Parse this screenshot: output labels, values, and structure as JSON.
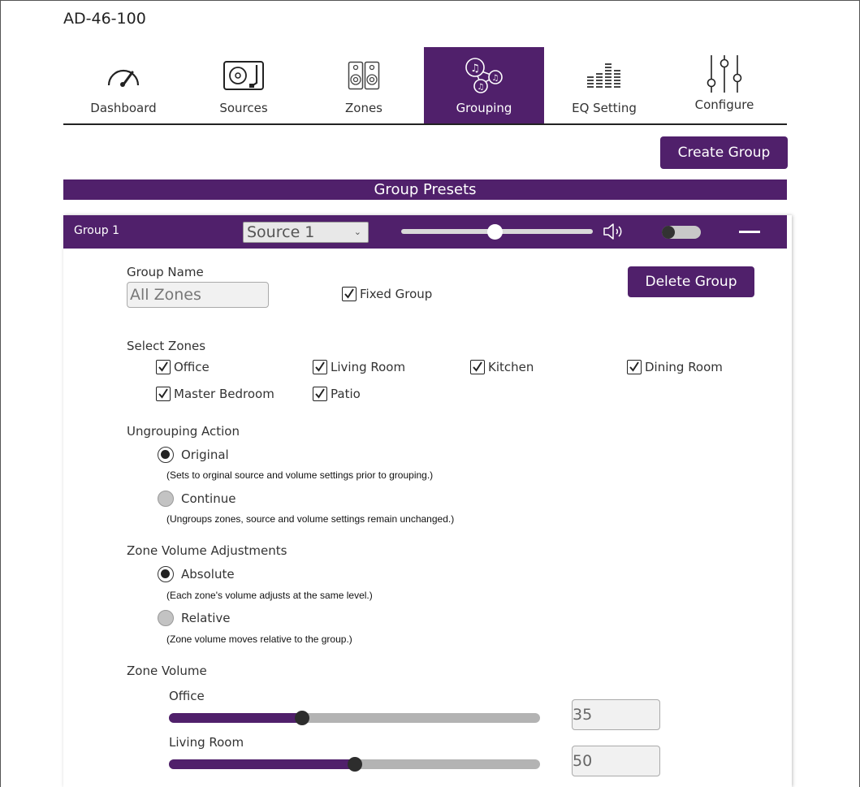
{
  "device": {
    "title": "AD-46-100"
  },
  "nav": {
    "tabs": [
      {
        "label": "Dashboard",
        "icon": "gauge-icon"
      },
      {
        "label": "Sources",
        "icon": "turntable-icon"
      },
      {
        "label": "Zones",
        "icon": "speakers-icon"
      },
      {
        "label": "Grouping",
        "icon": "music-group-icon",
        "active": true
      },
      {
        "label": "EQ Setting",
        "icon": "equalizer-icon"
      },
      {
        "label": "Configure",
        "icon": "sliders-icon"
      }
    ]
  },
  "actions": {
    "create_group": "Create Group"
  },
  "presets": {
    "title": "Group Presets"
  },
  "group": {
    "label": "Group 1",
    "source": "Source 1",
    "volume_fraction": 0.49,
    "enabled": false,
    "name_label": "Group Name",
    "name_value": "All Zones",
    "fixed_label": "Fixed Group",
    "fixed_checked": true,
    "delete_label": "Delete Group"
  },
  "zones": {
    "title": "Select Zones",
    "items": [
      {
        "label": "Office",
        "checked": true
      },
      {
        "label": "Living Room",
        "checked": true
      },
      {
        "label": "Kitchen",
        "checked": true
      },
      {
        "label": "Dining Room",
        "checked": true
      },
      {
        "label": "Master Bedroom",
        "checked": true
      },
      {
        "label": "Patio",
        "checked": true
      }
    ]
  },
  "ungrouping": {
    "title": "Ungrouping Action",
    "options": [
      {
        "label": "Original",
        "note": "(Sets to orginal source and volume settings prior to grouping.)",
        "selected": true
      },
      {
        "label": "Continue",
        "note": "(Ungroups zones, source and volume settings remain unchanged.)",
        "selected": false
      }
    ]
  },
  "adjustments": {
    "title": "Zone Volume Adjustments",
    "options": [
      {
        "label": "Absolute",
        "note": "(Each zone's volume adjusts at the same level.)",
        "selected": true
      },
      {
        "label": "Relative",
        "note": "(Zone volume moves relative to the group.)",
        "selected": false
      }
    ]
  },
  "zone_volume": {
    "title": "Zone Volume",
    "items": [
      {
        "label": "Office",
        "value": "35"
      },
      {
        "label": "Living Room",
        "value": "50"
      }
    ]
  },
  "colors": {
    "accent": "#50206b"
  }
}
